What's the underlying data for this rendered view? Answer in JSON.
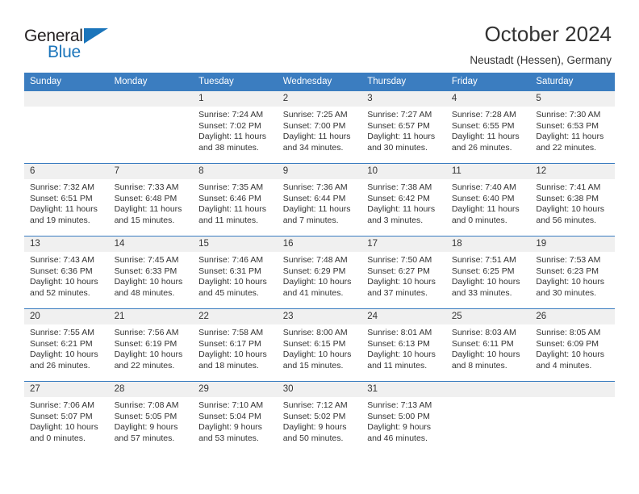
{
  "brand": {
    "name_top": "General",
    "name_bottom": "Blue",
    "accent_color": "#1b75bb"
  },
  "header": {
    "title": "October 2024",
    "location": "Neustadt (Hessen), Germany"
  },
  "calendar": {
    "header_bg": "#3b7dc0",
    "daynum_bg": "#f0f0f0",
    "weekdays": [
      "Sunday",
      "Monday",
      "Tuesday",
      "Wednesday",
      "Thursday",
      "Friday",
      "Saturday"
    ],
    "weeks": [
      [
        {
          "day": "",
          "empty": true
        },
        {
          "day": "",
          "empty": true
        },
        {
          "day": "1",
          "sunrise": "Sunrise: 7:24 AM",
          "sunset": "Sunset: 7:02 PM",
          "daylight1": "Daylight: 11 hours",
          "daylight2": "and 38 minutes."
        },
        {
          "day": "2",
          "sunrise": "Sunrise: 7:25 AM",
          "sunset": "Sunset: 7:00 PM",
          "daylight1": "Daylight: 11 hours",
          "daylight2": "and 34 minutes."
        },
        {
          "day": "3",
          "sunrise": "Sunrise: 7:27 AM",
          "sunset": "Sunset: 6:57 PM",
          "daylight1": "Daylight: 11 hours",
          "daylight2": "and 30 minutes."
        },
        {
          "day": "4",
          "sunrise": "Sunrise: 7:28 AM",
          "sunset": "Sunset: 6:55 PM",
          "daylight1": "Daylight: 11 hours",
          "daylight2": "and 26 minutes."
        },
        {
          "day": "5",
          "sunrise": "Sunrise: 7:30 AM",
          "sunset": "Sunset: 6:53 PM",
          "daylight1": "Daylight: 11 hours",
          "daylight2": "and 22 minutes."
        }
      ],
      [
        {
          "day": "6",
          "sunrise": "Sunrise: 7:32 AM",
          "sunset": "Sunset: 6:51 PM",
          "daylight1": "Daylight: 11 hours",
          "daylight2": "and 19 minutes."
        },
        {
          "day": "7",
          "sunrise": "Sunrise: 7:33 AM",
          "sunset": "Sunset: 6:48 PM",
          "daylight1": "Daylight: 11 hours",
          "daylight2": "and 15 minutes."
        },
        {
          "day": "8",
          "sunrise": "Sunrise: 7:35 AM",
          "sunset": "Sunset: 6:46 PM",
          "daylight1": "Daylight: 11 hours",
          "daylight2": "and 11 minutes."
        },
        {
          "day": "9",
          "sunrise": "Sunrise: 7:36 AM",
          "sunset": "Sunset: 6:44 PM",
          "daylight1": "Daylight: 11 hours",
          "daylight2": "and 7 minutes."
        },
        {
          "day": "10",
          "sunrise": "Sunrise: 7:38 AM",
          "sunset": "Sunset: 6:42 PM",
          "daylight1": "Daylight: 11 hours",
          "daylight2": "and 3 minutes."
        },
        {
          "day": "11",
          "sunrise": "Sunrise: 7:40 AM",
          "sunset": "Sunset: 6:40 PM",
          "daylight1": "Daylight: 11 hours",
          "daylight2": "and 0 minutes."
        },
        {
          "day": "12",
          "sunrise": "Sunrise: 7:41 AM",
          "sunset": "Sunset: 6:38 PM",
          "daylight1": "Daylight: 10 hours",
          "daylight2": "and 56 minutes."
        }
      ],
      [
        {
          "day": "13",
          "sunrise": "Sunrise: 7:43 AM",
          "sunset": "Sunset: 6:36 PM",
          "daylight1": "Daylight: 10 hours",
          "daylight2": "and 52 minutes."
        },
        {
          "day": "14",
          "sunrise": "Sunrise: 7:45 AM",
          "sunset": "Sunset: 6:33 PM",
          "daylight1": "Daylight: 10 hours",
          "daylight2": "and 48 minutes."
        },
        {
          "day": "15",
          "sunrise": "Sunrise: 7:46 AM",
          "sunset": "Sunset: 6:31 PM",
          "daylight1": "Daylight: 10 hours",
          "daylight2": "and 45 minutes."
        },
        {
          "day": "16",
          "sunrise": "Sunrise: 7:48 AM",
          "sunset": "Sunset: 6:29 PM",
          "daylight1": "Daylight: 10 hours",
          "daylight2": "and 41 minutes."
        },
        {
          "day": "17",
          "sunrise": "Sunrise: 7:50 AM",
          "sunset": "Sunset: 6:27 PM",
          "daylight1": "Daylight: 10 hours",
          "daylight2": "and 37 minutes."
        },
        {
          "day": "18",
          "sunrise": "Sunrise: 7:51 AM",
          "sunset": "Sunset: 6:25 PM",
          "daylight1": "Daylight: 10 hours",
          "daylight2": "and 33 minutes."
        },
        {
          "day": "19",
          "sunrise": "Sunrise: 7:53 AM",
          "sunset": "Sunset: 6:23 PM",
          "daylight1": "Daylight: 10 hours",
          "daylight2": "and 30 minutes."
        }
      ],
      [
        {
          "day": "20",
          "sunrise": "Sunrise: 7:55 AM",
          "sunset": "Sunset: 6:21 PM",
          "daylight1": "Daylight: 10 hours",
          "daylight2": "and 26 minutes."
        },
        {
          "day": "21",
          "sunrise": "Sunrise: 7:56 AM",
          "sunset": "Sunset: 6:19 PM",
          "daylight1": "Daylight: 10 hours",
          "daylight2": "and 22 minutes."
        },
        {
          "day": "22",
          "sunrise": "Sunrise: 7:58 AM",
          "sunset": "Sunset: 6:17 PM",
          "daylight1": "Daylight: 10 hours",
          "daylight2": "and 18 minutes."
        },
        {
          "day": "23",
          "sunrise": "Sunrise: 8:00 AM",
          "sunset": "Sunset: 6:15 PM",
          "daylight1": "Daylight: 10 hours",
          "daylight2": "and 15 minutes."
        },
        {
          "day": "24",
          "sunrise": "Sunrise: 8:01 AM",
          "sunset": "Sunset: 6:13 PM",
          "daylight1": "Daylight: 10 hours",
          "daylight2": "and 11 minutes."
        },
        {
          "day": "25",
          "sunrise": "Sunrise: 8:03 AM",
          "sunset": "Sunset: 6:11 PM",
          "daylight1": "Daylight: 10 hours",
          "daylight2": "and 8 minutes."
        },
        {
          "day": "26",
          "sunrise": "Sunrise: 8:05 AM",
          "sunset": "Sunset: 6:09 PM",
          "daylight1": "Daylight: 10 hours",
          "daylight2": "and 4 minutes."
        }
      ],
      [
        {
          "day": "27",
          "sunrise": "Sunrise: 7:06 AM",
          "sunset": "Sunset: 5:07 PM",
          "daylight1": "Daylight: 10 hours",
          "daylight2": "and 0 minutes."
        },
        {
          "day": "28",
          "sunrise": "Sunrise: 7:08 AM",
          "sunset": "Sunset: 5:05 PM",
          "daylight1": "Daylight: 9 hours",
          "daylight2": "and 57 minutes."
        },
        {
          "day": "29",
          "sunrise": "Sunrise: 7:10 AM",
          "sunset": "Sunset: 5:04 PM",
          "daylight1": "Daylight: 9 hours",
          "daylight2": "and 53 minutes."
        },
        {
          "day": "30",
          "sunrise": "Sunrise: 7:12 AM",
          "sunset": "Sunset: 5:02 PM",
          "daylight1": "Daylight: 9 hours",
          "daylight2": "and 50 minutes."
        },
        {
          "day": "31",
          "sunrise": "Sunrise: 7:13 AM",
          "sunset": "Sunset: 5:00 PM",
          "daylight1": "Daylight: 9 hours",
          "daylight2": "and 46 minutes."
        },
        {
          "day": "",
          "empty": true
        },
        {
          "day": "",
          "empty": true
        }
      ]
    ]
  }
}
